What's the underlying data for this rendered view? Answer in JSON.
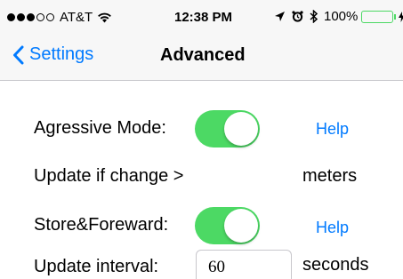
{
  "status_bar": {
    "carrier": "AT&T",
    "signal_bars_filled": 3,
    "signal_bars_total": 5,
    "time": "12:38 PM",
    "battery": "100%",
    "battery_color": "#4cd964"
  },
  "nav": {
    "back_label": "Settings",
    "title": "Advanced"
  },
  "settings": {
    "aggressive_mode": {
      "label": "Agressive Mode:",
      "enabled": true,
      "help_label": "Help"
    },
    "update_if_change": {
      "label": "Update if change >",
      "unit": "meters"
    },
    "store_forward": {
      "label": "Store&Foreward:",
      "enabled": true,
      "help_label": "Help"
    },
    "update_interval": {
      "label": "Update interval:",
      "value": "60",
      "unit": "seconds"
    }
  },
  "colors": {
    "accent": "#007aff",
    "toggle_on": "#4cd964"
  }
}
